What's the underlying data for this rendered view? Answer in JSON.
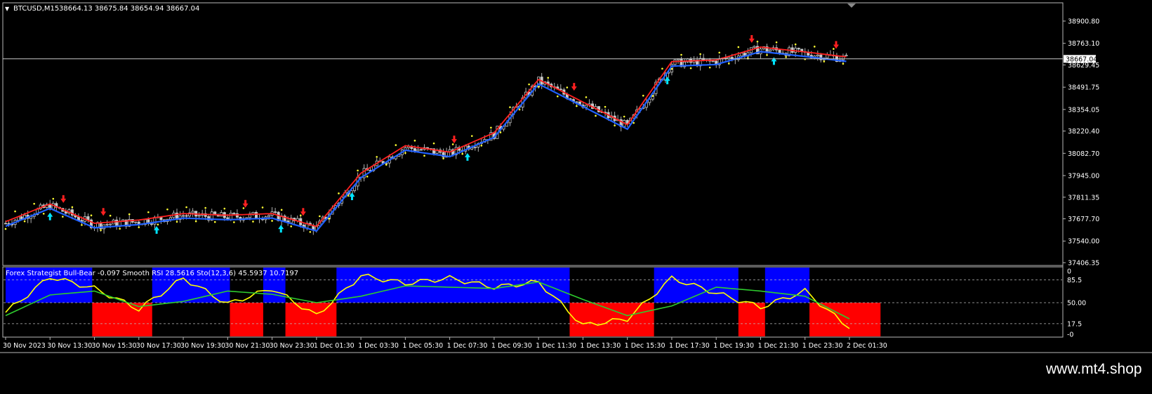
{
  "header": {
    "symbol": "BTCUSD,M15",
    "ohlc": "38664.13 38675.84 38654.94 38667.04"
  },
  "price_axis": {
    "ticks": [
      "38900.80",
      "38763.10",
      "38629.45",
      "38491.75",
      "38354.05",
      "38220.40",
      "38082.70",
      "37945.00",
      "37811.35",
      "37677.70",
      "37540.00",
      "37406.35"
    ],
    "current_price": "38667.04"
  },
  "indicator": {
    "label": "Forex Strategist Bull-Bear -0.097  Smooth RSI 28.5616  Sto(12,3,6) 45.5937 10.7197",
    "levels": [
      "0",
      "85.5",
      "50.00",
      "17.5",
      "-0"
    ]
  },
  "time_axis": {
    "labels": [
      "30 Nov 2023",
      "30 Nov 13:30",
      "30 Nov 15:30",
      "30 Nov 17:30",
      "30 Nov 19:30",
      "30 Nov 21:30",
      "30 Nov 23:30",
      "1 Dec 01:30",
      "1 Dec 03:30",
      "1 Dec 05:30",
      "1 Dec 07:30",
      "1 Dec 09:30",
      "1 Dec 11:30",
      "1 Dec 13:30",
      "1 Dec 15:30",
      "1 Dec 17:30",
      "1 Dec 19:30",
      "1 Dec 21:30",
      "1 Dec 23:30",
      "2 Dec 01:30"
    ]
  },
  "watermark": "www.mt4.shop",
  "colors": {
    "background": "#000000",
    "bull_band": "#0000ff",
    "bear_band": "#ff0000",
    "rsi": "#ffff00",
    "smooth": "#2ecc2e",
    "ma_red": "#ff2020",
    "ma_blue": "#2060ff",
    "dots": "#ffff33",
    "arrow_up": "#00e5ff",
    "arrow_down": "#ff2020"
  },
  "chart_data": [
    {
      "type": "candlestick",
      "symbol": "BTCUSD",
      "timeframe": "M15",
      "ylim": [
        37406.35,
        38900.8
      ],
      "x": [
        "30 Nov 2023",
        "30 Nov 13:30",
        "30 Nov 15:30",
        "30 Nov 17:30",
        "30 Nov 19:30",
        "30 Nov 21:30",
        "30 Nov 23:30",
        "1 Dec 01:30",
        "1 Dec 03:30",
        "1 Dec 05:30",
        "1 Dec 07:30",
        "1 Dec 09:30",
        "1 Dec 11:30",
        "1 Dec 13:30",
        "1 Dec 15:30",
        "1 Dec 17:30",
        "1 Dec 19:30",
        "1 Dec 21:30",
        "1 Dec 23:30",
        "2 Dec 01:30"
      ],
      "series": [
        {
          "values": [
            37650,
            37760,
            37640,
            37660,
            37700,
            37690,
            37700,
            37620,
            37950,
            38120,
            38080,
            38200,
            38530,
            38390,
            38250,
            38640,
            38650,
            38730,
            38700,
            38667
          ]
        }
      ],
      "current_price": 38667.04
    },
    {
      "type": "line",
      "title": "Forex Strategist Bull-Bear",
      "ylim": [
        0,
        100
      ],
      "levels": [
        17.5,
        50,
        85.5
      ],
      "x": [
        "30 Nov 2023",
        "30 Nov 13:30",
        "30 Nov 15:30",
        "30 Nov 17:30",
        "30 Nov 19:30",
        "30 Nov 21:30",
        "30 Nov 23:30",
        "1 Dec 01:30",
        "1 Dec 03:30",
        "1 Dec 05:30",
        "1 Dec 07:30",
        "1 Dec 09:30",
        "1 Dec 11:30",
        "1 Dec 13:30",
        "1 Dec 15:30",
        "1 Dec 17:30",
        "1 Dec 19:30",
        "1 Dec 21:30",
        "1 Dec 23:30",
        "2 Dec 01:30"
      ],
      "series": [
        {
          "name": "Smooth RSI",
          "values": [
            35,
            90,
            72,
            40,
            88,
            48,
            72,
            30,
            92,
            80,
            88,
            74,
            82,
            15,
            25,
            88,
            65,
            43,
            68,
            10
          ]
        },
        {
          "name": "Sto(12,3,6)",
          "values": [
            30,
            62,
            68,
            44,
            52,
            68,
            63,
            50,
            60,
            76,
            74,
            72,
            82,
            55,
            30,
            45,
            74,
            68,
            60,
            25
          ]
        }
      ],
      "bands": [
        {
          "kind": "bull",
          "from": 0,
          "to": 1.95
        },
        {
          "kind": "bear",
          "from": 1.95,
          "to": 3.3
        },
        {
          "kind": "bull",
          "from": 3.3,
          "to": 5.05
        },
        {
          "kind": "bear",
          "from": 5.05,
          "to": 5.8
        },
        {
          "kind": "bull",
          "from": 5.8,
          "to": 6.3
        },
        {
          "kind": "bear",
          "from": 6.3,
          "to": 7.45
        },
        {
          "kind": "bull",
          "from": 7.45,
          "to": 12.7
        },
        {
          "kind": "bear",
          "from": 12.7,
          "to": 14.6
        },
        {
          "kind": "bull",
          "from": 14.6,
          "to": 16.5
        },
        {
          "kind": "bear",
          "from": 16.5,
          "to": 17.1
        },
        {
          "kind": "bull",
          "from": 17.1,
          "to": 18.1
        },
        {
          "kind": "bear",
          "from": 18.1,
          "to": 19.7
        }
      ]
    }
  ]
}
